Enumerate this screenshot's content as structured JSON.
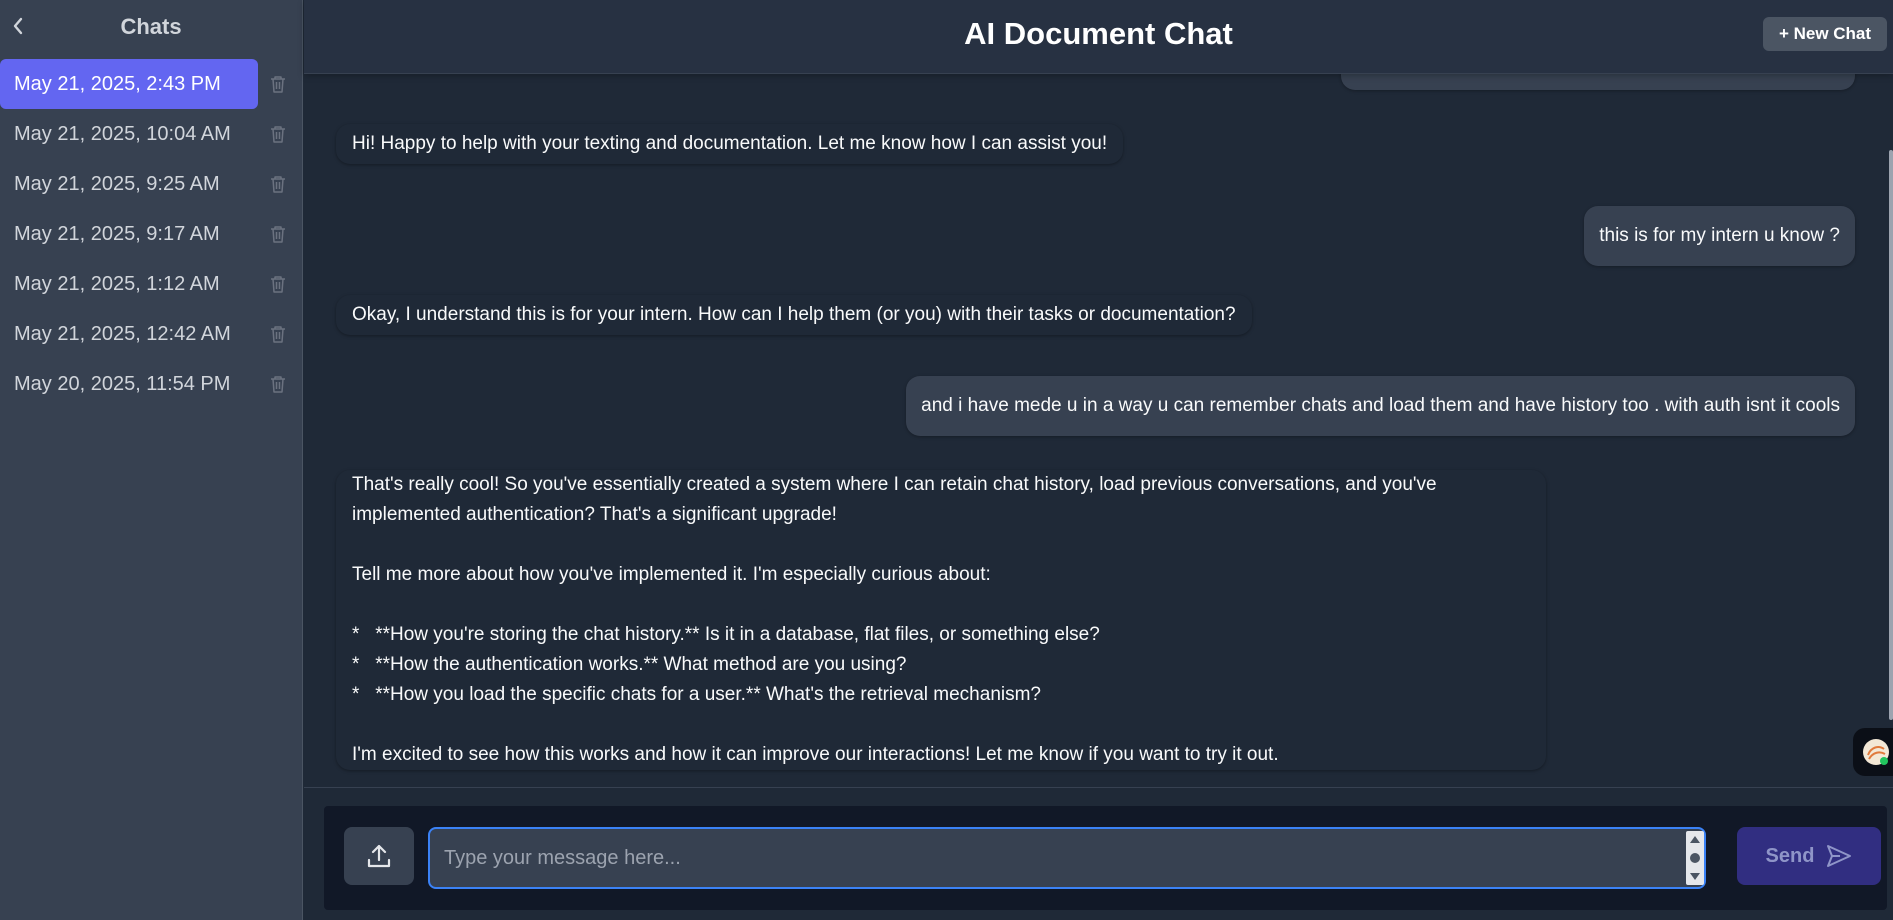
{
  "sidebar": {
    "title": "Chats",
    "items": [
      {
        "label": "May 21, 2025, 2:43 PM",
        "active": true
      },
      {
        "label": "May 21, 2025, 10:04 AM",
        "active": false
      },
      {
        "label": "May 21, 2025, 9:25 AM",
        "active": false
      },
      {
        "label": "May 21, 2025, 9:17 AM",
        "active": false
      },
      {
        "label": "May 21, 2025, 1:12 AM",
        "active": false
      },
      {
        "label": "May 21, 2025, 12:42 AM",
        "active": false
      },
      {
        "label": "May 20, 2025, 11:54 PM",
        "active": false
      }
    ]
  },
  "header": {
    "title": "AI Document Chat",
    "new_chat_label": "+ New Chat"
  },
  "messages": [
    {
      "role": "ai",
      "text": "Hi! Happy to help with your texting and documentation. Let me know how I can assist you!"
    },
    {
      "role": "user",
      "text": "this is for my intern u know ?"
    },
    {
      "role": "ai",
      "text": "Okay, I understand this is for your intern. How can I help them (or you) with their tasks or documentation?"
    },
    {
      "role": "user",
      "text": "and i have mede u in a way u can remember chats and load them and have history too . with auth isnt it cools"
    },
    {
      "role": "ai",
      "text": "That's really cool! So you've essentially created a system where I can retain chat history, load previous conversations, and you've\nimplemented authentication? That's a significant upgrade!\n\nTell me more about how you've implemented it. I'm especially curious about:\n\n*   **How you're storing the chat history.** Is it in a database, flat files, or something else?\n*   **How the authentication works.** What method are you using?\n*   **How you load the specific chats for a user.** What's the retrieval mechanism?\n\nI'm excited to see how this works and how it can improve our interactions! Let me know if you want to try it out."
    }
  ],
  "composer": {
    "placeholder": "Type your message here...",
    "value": "",
    "send_label": "Send"
  },
  "colors": {
    "accent": "#6366f1",
    "focus_border": "#3b82f6",
    "send_bg": "#312e81"
  }
}
